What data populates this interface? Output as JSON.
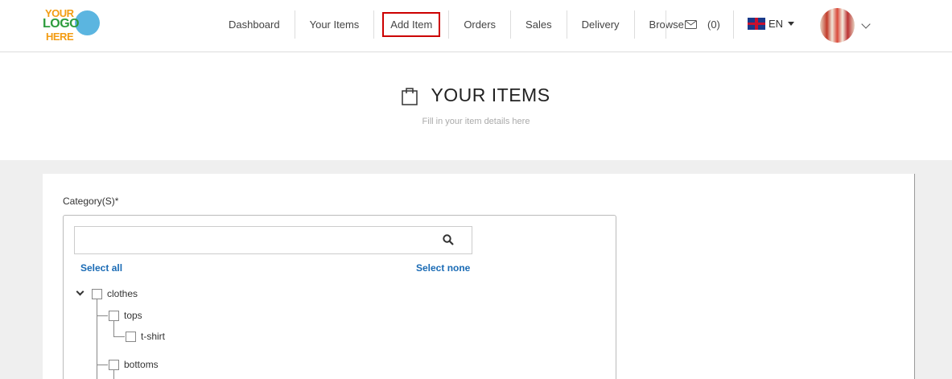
{
  "logo": {
    "line1": "YOUR",
    "line2": "LOGO",
    "line3": "HERE"
  },
  "nav": {
    "items": [
      {
        "label": "Dashboard"
      },
      {
        "label": "Your Items"
      },
      {
        "label": "Add Item",
        "active": true
      },
      {
        "label": "Orders"
      },
      {
        "label": "Sales"
      },
      {
        "label": "Delivery"
      },
      {
        "label": "Browse"
      }
    ]
  },
  "messages": {
    "count": "(0)",
    "icon": "mail-icon"
  },
  "language": {
    "code": "EN",
    "icon": "uk-flag-icon"
  },
  "page": {
    "title": "YOUR ITEMS",
    "subtitle": "Fill in your item details here",
    "icon": "shopping-bag-icon"
  },
  "form": {
    "category_label": "Category(S)*",
    "search_value": "",
    "select_all": "Select all",
    "select_none": "Select none",
    "tree": [
      {
        "label": "clothes"
      },
      {
        "label": "tops"
      },
      {
        "label": "t-shirt"
      },
      {
        "label": "bottoms"
      }
    ]
  },
  "colors": {
    "accent_link": "#1a6bb5",
    "active_border": "#cc0000",
    "content_bg": "#efefef"
  }
}
